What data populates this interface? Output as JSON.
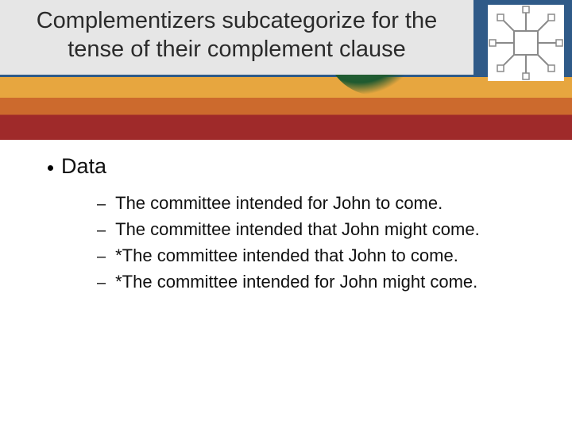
{
  "title": "Complementizers subcategorize for the tense of their complement clause",
  "content": {
    "heading": "Data",
    "items": [
      "The committee intended for John to come.",
      "The committee intended that John might come.",
      "*The committee intended that John to come.",
      "*The committee intended for John might come."
    ]
  }
}
